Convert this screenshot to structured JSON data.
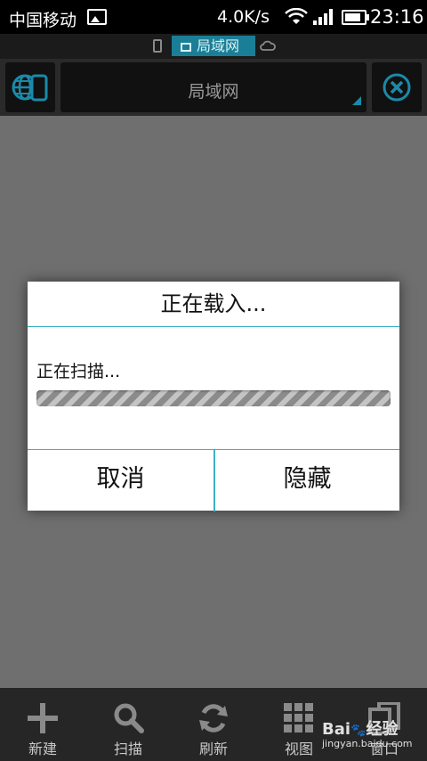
{
  "status": {
    "carrier": "中国移动",
    "speed": "4.0K/s",
    "time": "23:16"
  },
  "mode": {
    "lan_tab": "局域网"
  },
  "toolbar": {
    "title": "局域网"
  },
  "dialog": {
    "title": "正在载入...",
    "message": "正在扫描...",
    "cancel": "取消",
    "hide": "隐藏"
  },
  "bottom": {
    "items": [
      {
        "label": "新建",
        "icon": "plus-icon"
      },
      {
        "label": "扫描",
        "icon": "search-icon"
      },
      {
        "label": "刷新",
        "icon": "refresh-icon"
      },
      {
        "label": "视图",
        "icon": "grid-view-icon"
      },
      {
        "label": "窗口",
        "icon": "windows-icon"
      }
    ]
  },
  "watermark": {
    "brand": "Bai",
    "brand2": "经验",
    "sub": "jingyan.baidu.com"
  },
  "colors": {
    "accent": "#1a8aa8",
    "divider": "#3ab0c8"
  }
}
